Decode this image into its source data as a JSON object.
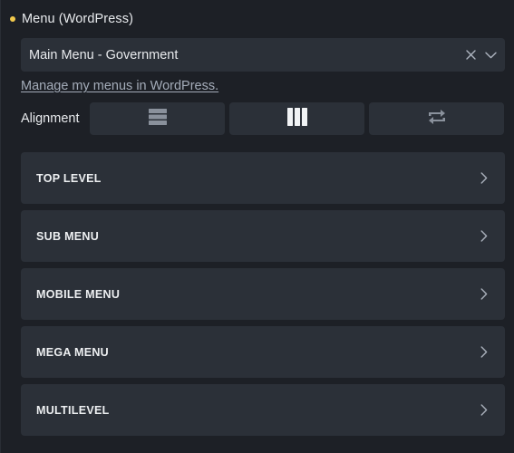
{
  "header": {
    "title": "Menu (WordPress)",
    "status_color": "#f2c94c",
    "status_icon": "status-dot"
  },
  "menu_select": {
    "value": "Main Menu - Government",
    "clear_icon": "close-icon",
    "dropdown_icon": "chevron-down-icon"
  },
  "manage_link": {
    "label": "Manage my menus in WordPress."
  },
  "alignment": {
    "label": "Alignment",
    "options": [
      {
        "name": "align-row-button",
        "icon": "rows-icon"
      },
      {
        "name": "align-column-button",
        "icon": "columns-icon",
        "selected": true
      },
      {
        "name": "align-reverse-button",
        "icon": "swap-icon"
      }
    ]
  },
  "sections": {
    "items": [
      {
        "label": "TOP LEVEL",
        "icon": "chevron-right-icon"
      },
      {
        "label": "SUB MENU",
        "icon": "chevron-right-icon"
      },
      {
        "label": "MOBILE MENU",
        "icon": "chevron-right-icon"
      },
      {
        "label": "MEGA MENU",
        "icon": "chevron-right-icon"
      },
      {
        "label": "MULTILEVEL",
        "icon": "chevron-right-icon"
      }
    ]
  },
  "colors": {
    "background": "#1d2026",
    "surface": "#2b3038",
    "text": "#e8eaed",
    "muted": "#a4acb9"
  }
}
